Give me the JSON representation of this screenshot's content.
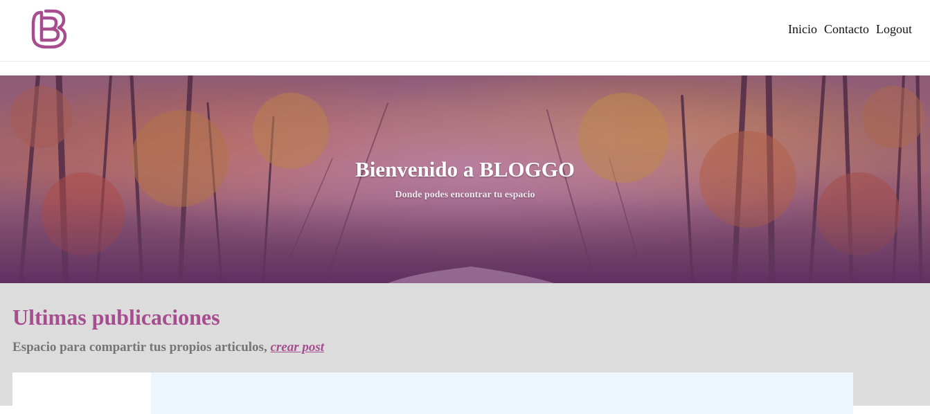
{
  "header": {
    "logo_icon": "bloggo-logo-icon",
    "brand_color": "#a64d8f",
    "nav": [
      {
        "label": "Inicio"
      },
      {
        "label": "Contacto"
      },
      {
        "label": "Logout"
      }
    ]
  },
  "hero": {
    "title": "Bienvenido a BLOGGO",
    "subtitle": "Donde podes encontrar tu espacio"
  },
  "main": {
    "title": "Ultimas publicaciones",
    "description": "Espacio para compartir tus propios articulos, ",
    "create_link": "crear post"
  }
}
